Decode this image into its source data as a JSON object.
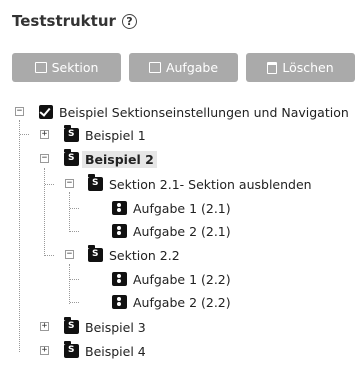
{
  "header": {
    "title": "Teststruktur",
    "help_icon": "?"
  },
  "toolbar": {
    "section_label": "Sektion",
    "task_label": "Aufgabe",
    "delete_label": "Löschen"
  },
  "tree": {
    "root": "Beispiel Sektionseinstellungen und Navigation",
    "b1": "Beispiel 1",
    "b2": "Beispiel 2",
    "s21": "Sektion 2.1- Sektion ausblenden",
    "a211": "Aufgabe 1 (2.1)",
    "a212": "Aufgabe 2 (2.1)",
    "s22": "Sektion 2.2",
    "a221": "Aufgabe 1 (2.2)",
    "a222": "Aufgabe 2 (2.2)",
    "b3": "Beispiel 3",
    "b4": "Beispiel 4"
  },
  "colors": {
    "button_bg": "#aaaaaa",
    "selected_bg": "#e6e6e6"
  }
}
